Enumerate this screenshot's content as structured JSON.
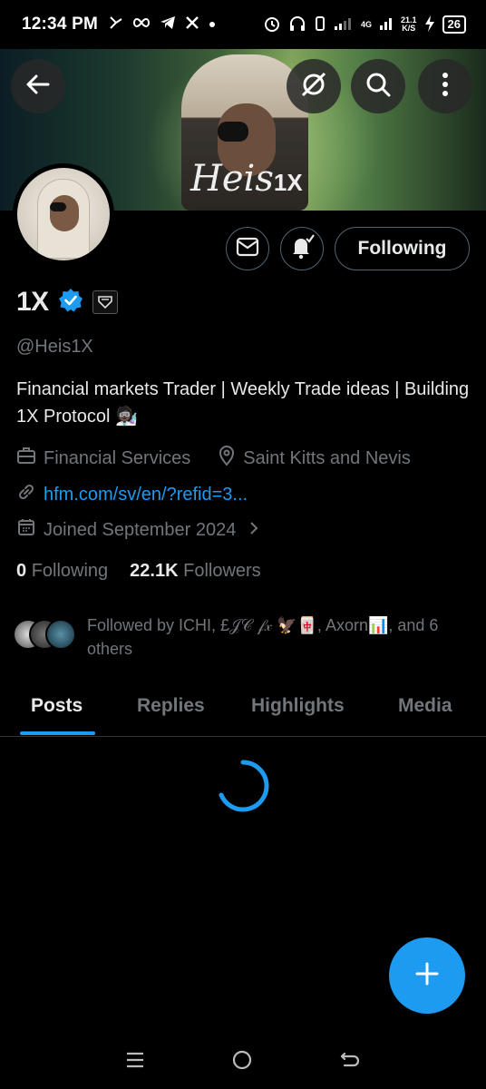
{
  "status_bar": {
    "time": "12:34 PM",
    "network_label": "4G",
    "speed_value": "21.1",
    "speed_unit": "K/S",
    "battery": "26",
    "icons": [
      "bluesky-icon",
      "infinity-icon",
      "telegram-icon",
      "x-logo-icon",
      "dot-icon",
      "alarm-icon",
      "headphones-icon",
      "vibrate-icon",
      "signal-icon",
      "signal-4g-icon",
      "charging-icon"
    ]
  },
  "header": {
    "back_icon": "back-arrow-icon",
    "grok_icon": "grok-icon",
    "search_icon": "search-icon",
    "more_icon": "more-vertical-icon",
    "banner_signature": "Heis",
    "banner_signature_suffix": "1X"
  },
  "profile": {
    "name": "1X",
    "verified": true,
    "handle": "@Heis1X",
    "bio": "Financial markets Trader | Weekly Trade ideas | Building 1X Protocol 🧑🏿‍🔬",
    "category": "Financial Services",
    "location": "Saint Kitts and Nevis",
    "link": "hfm.com/sv/en/?refid=3...",
    "joined": "Joined September 2024",
    "following_count": "0",
    "following_label": "Following",
    "followers_count": "22.1K",
    "followers_label": "Followers",
    "followed_by": "Followed by ICHI, £𝒥𝒞 𝒻𝓍 🦅🀄, Axorn📊, and 6 others"
  },
  "actions": {
    "message_icon": "mail-icon",
    "notify_icon": "bell-check-icon",
    "following_button": "Following"
  },
  "tabs": [
    {
      "label": "Posts",
      "active": true
    },
    {
      "label": "Replies",
      "active": false
    },
    {
      "label": "Highlights",
      "active": false
    },
    {
      "label": "Media",
      "active": false
    }
  ],
  "colors": {
    "accent": "#1d9bf0",
    "muted": "#71767b",
    "text": "#e7e9ea",
    "background": "#000000"
  },
  "fab_icon": "plus-icon",
  "nav": [
    "recents-icon",
    "home-icon",
    "back-icon"
  ]
}
